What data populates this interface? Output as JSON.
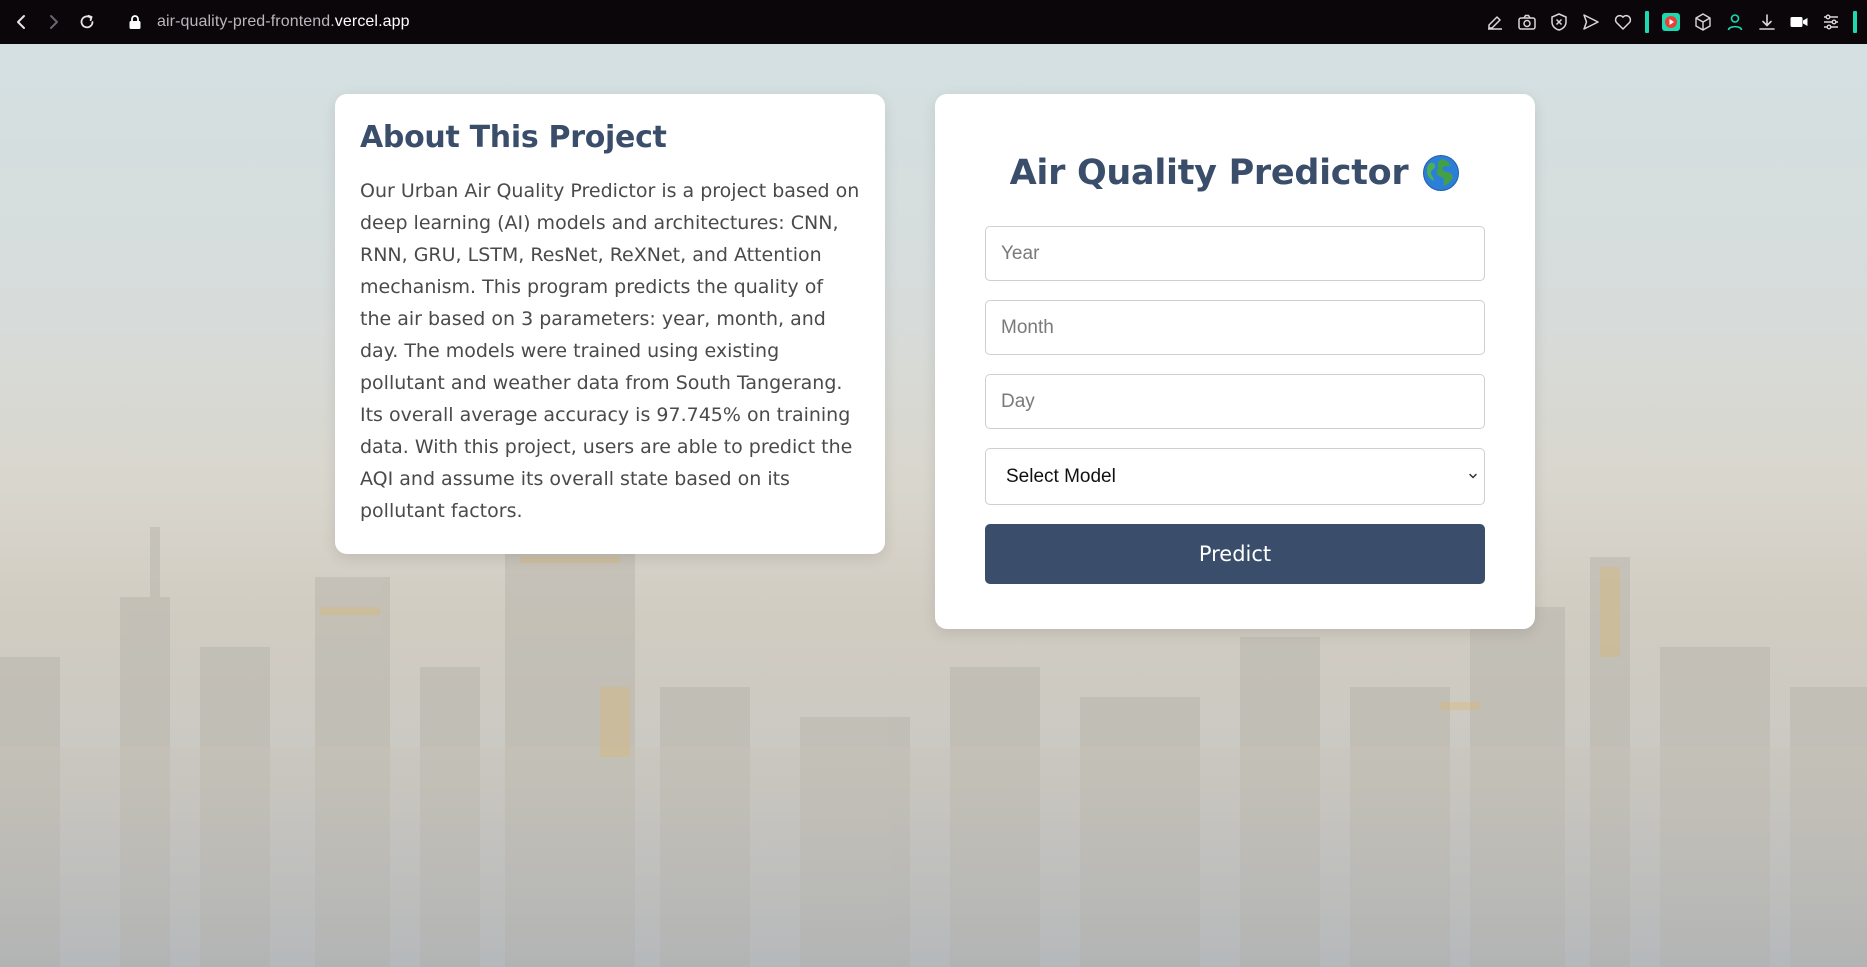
{
  "browser": {
    "url_prefix": "air-quality-pred-frontend.",
    "url_host": "vercel.app",
    "accent_color": "#1ed8b0"
  },
  "about": {
    "title": "About This Project",
    "body": "Our Urban Air Quality Predictor is a project based on deep learning (AI) models and architectures: CNN, RNN, GRU, LSTM, ResNet, ReXNet, and Attention mechanism. This program predicts the quality of the air based on 3 parameters: year, month, and day. The models were trained using existing pollutant and weather data from South Tangerang. Its overall average accuracy is 97.745% on training data. With this project, users are able to predict the AQI and assume its overall state based on its pollutant factors."
  },
  "predictor": {
    "title": "Air Quality Predictor",
    "title_icon": "globe-icon",
    "year_placeholder": "Year",
    "month_placeholder": "Month",
    "day_placeholder": "Day",
    "model_select_value": "Select Model",
    "predict_label": "Predict",
    "primary_color": "#3a4e6b"
  }
}
